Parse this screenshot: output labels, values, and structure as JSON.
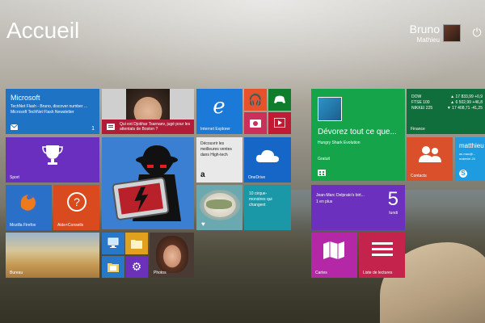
{
  "header": {
    "title": "Accueil"
  },
  "user": {
    "name": "Bruno",
    "subtitle": "Mathieu"
  },
  "tiles": {
    "mail": {
      "title": "Microsoft",
      "line1": "TechNet Flash - Bruno, discover number ...",
      "line2": "Microsoft TechNet Flash Newsletter",
      "badge": "1"
    },
    "news": {
      "headline": "Qui est Djokhar Tsarnaev, jugé pour les attentats de Boston ?"
    },
    "ie": {
      "label": "Internet Explorer"
    },
    "sport": {
      "label": "Sport"
    },
    "amazon": {
      "line1": "Découvrir les",
      "line2": "meilleures ventes",
      "line3": "dans High-tech",
      "logo": "a"
    },
    "onedrive": {
      "label": "OneDrive"
    },
    "firefox": {
      "label": "Mozilla Firefox"
    },
    "help": {
      "label": "Aide+Conseils"
    },
    "health": {
      "line1": "10 cirque-",
      "line2": "monstres qui",
      "line3": "changent"
    },
    "desktop": {
      "label": "Bureau"
    },
    "photos": {
      "label": "Photos"
    },
    "store": {
      "headline": "Dévorez tout ce que...",
      "sub": "Hungry Shark Evolution",
      "price": "Gratuit"
    },
    "finance": {
      "rows": [
        {
          "name": "DOW",
          "value": "▲ 17 833,99 +0,9"
        },
        {
          "name": "FTSE 100",
          "value": "▲ 6 502,99 +46,8"
        },
        {
          "name": "NIKKEI 225",
          "value": "▼ 17 408,71 -41,25"
        }
      ],
      "label": "Finance"
    },
    "contacts": {
      "label": "Contacts"
    },
    "skype": {
      "name": "matthieu",
      "sub1": "as mac@...",
      "sub2": "materiel.20"
    },
    "calendar": {
      "event": "Jean-Marc Delprato's birt...",
      "when": "1 en plus",
      "day": "5",
      "dayname": "lundi"
    },
    "maps": {
      "label": "Cartes"
    },
    "reading": {
      "label": "Liste de lectures"
    }
  }
}
